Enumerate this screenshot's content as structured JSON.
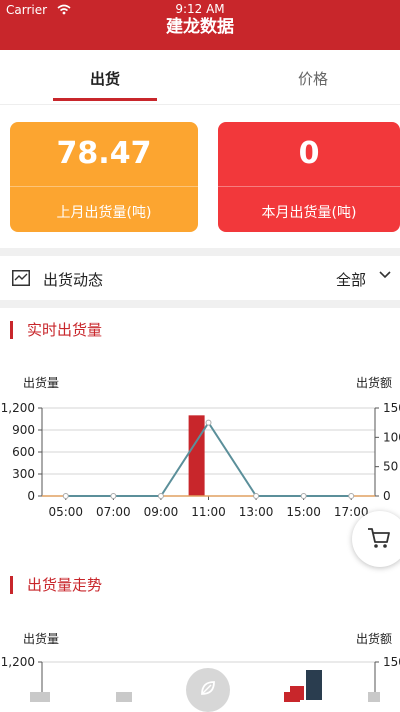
{
  "status_bar": {
    "carrier": "Carrier",
    "time": "9:12 AM"
  },
  "nav": {
    "title": "建龙数据"
  },
  "tabs": [
    {
      "label": "出货"
    },
    {
      "label": "价格"
    }
  ],
  "cards": [
    {
      "value": "78.47",
      "label": "上月出货量(吨)",
      "color": "#fca530"
    },
    {
      "value": "0",
      "label": "本月出货量(吨)",
      "color": "#f2383b"
    }
  ],
  "section": {
    "label": "出货动态",
    "filter": "全部"
  },
  "chart_data": [
    {
      "type": "bar",
      "title": "实时出货量",
      "ylabel_left": "出货量",
      "ylabel_right": "出货额",
      "x_ticks": [
        "05:00",
        "07:00",
        "09:00",
        "11:00",
        "13:00",
        "15:00",
        "17:00"
      ],
      "y_left_ticks": [
        "0",
        "300",
        "600",
        "900",
        "1,200"
      ],
      "y_right_ticks": [
        "0",
        "50",
        "100",
        "150"
      ],
      "ylim_left": [
        0,
        1200
      ],
      "ylim_right": [
        0,
        150
      ],
      "bar_series": {
        "x": [
          10.5
        ],
        "values": [
          1100
        ],
        "color": "#c8262b"
      },
      "line_series": {
        "x": [
          5,
          7,
          9,
          11,
          13,
          15,
          17
        ],
        "values": [
          0,
          0,
          0,
          125,
          0,
          0,
          0
        ],
        "color": "#5b8f9a"
      },
      "baseline_color": "#e0a060",
      "grid": true
    },
    {
      "type": "bar",
      "title": "出货量走势",
      "ylabel_left": "出货量",
      "ylabel_right": "出货额",
      "y_left_ticks": [
        "1,200"
      ],
      "y_right_ticks": [
        "150"
      ],
      "partial": true
    }
  ]
}
